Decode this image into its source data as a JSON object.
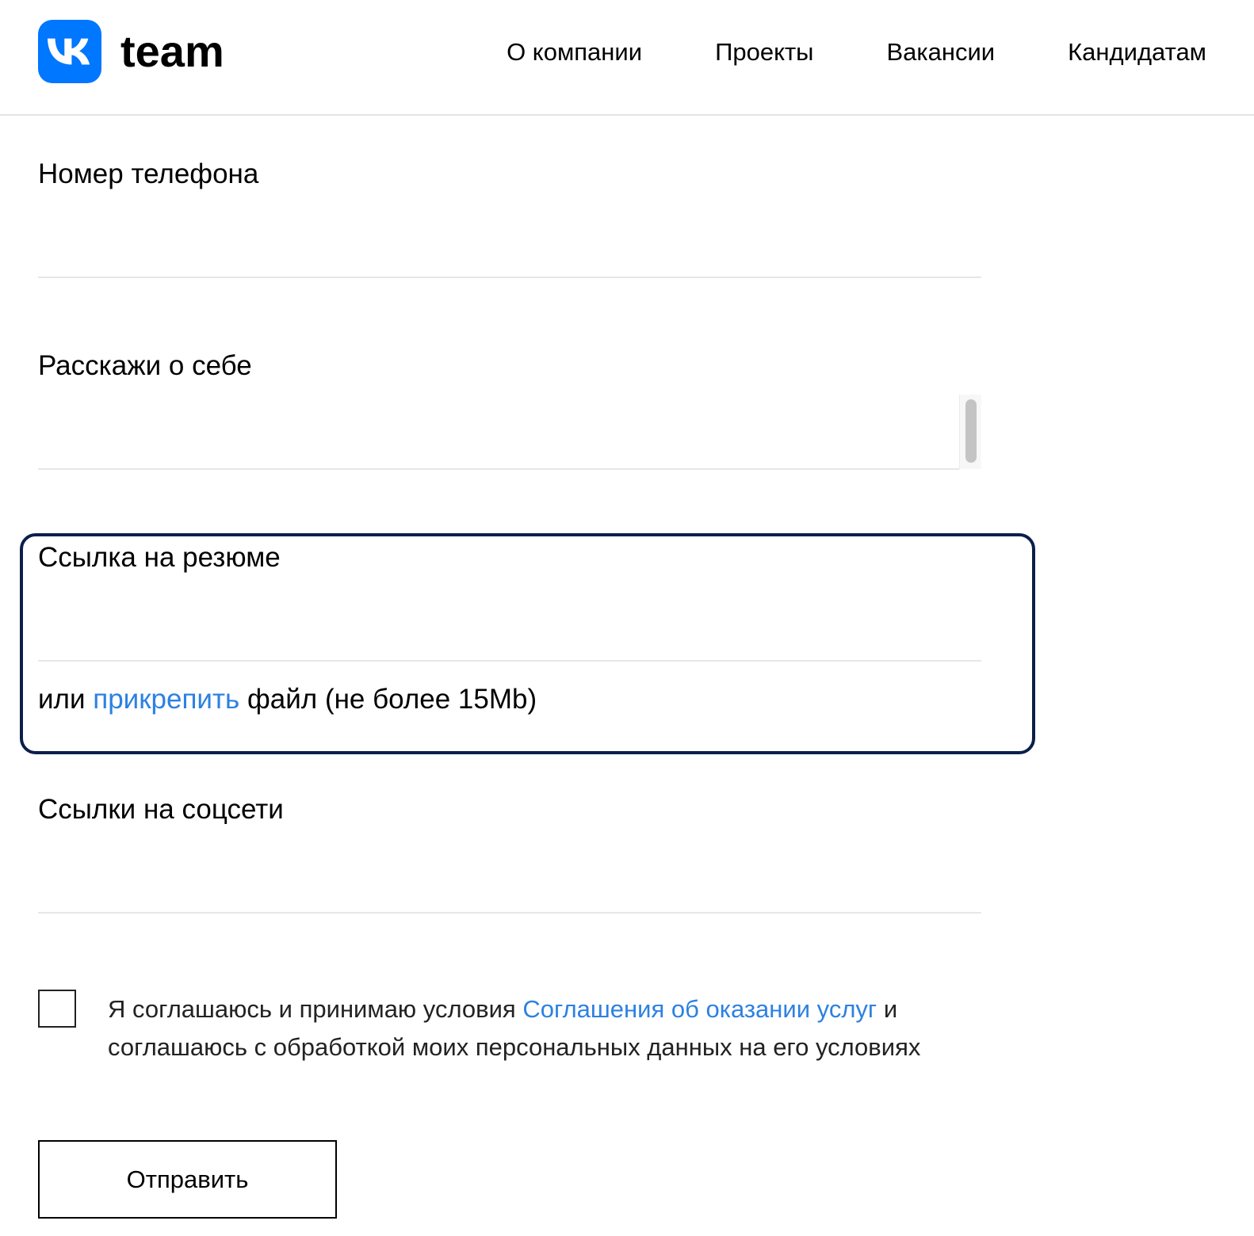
{
  "header": {
    "logo_text": "team",
    "brand_color": "#0077ff",
    "nav": [
      {
        "label": "О компании"
      },
      {
        "label": "Проекты"
      },
      {
        "label": "Вакансии"
      },
      {
        "label": "Кандидатам"
      }
    ]
  },
  "form": {
    "phone": {
      "label": "Номер телефона",
      "value": "",
      "placeholder": ""
    },
    "about": {
      "label": "Расскажи о себе",
      "value": "",
      "placeholder": ""
    },
    "resume": {
      "label": "Ссылка на резюме",
      "value": "",
      "placeholder": "",
      "attach_prefix": "или",
      "attach_link": "прикрепить",
      "attach_suffix": "файл (не более 15Mb)",
      "focused": true
    },
    "social": {
      "label": "Ссылки на соцсети",
      "value": "",
      "placeholder": ""
    },
    "agreement": {
      "checked": false,
      "text_before": "Я соглашаюсь и принимаю условия",
      "link_text": "Соглашения об оказании услуг",
      "text_after": "и соглашаюсь с обработкой моих персональных данных на его условиях"
    },
    "submit_label": "Отправить"
  },
  "colors": {
    "link": "#2d81e0",
    "focus_ring": "#0b1f4b",
    "divider": "#e6e7e8"
  }
}
